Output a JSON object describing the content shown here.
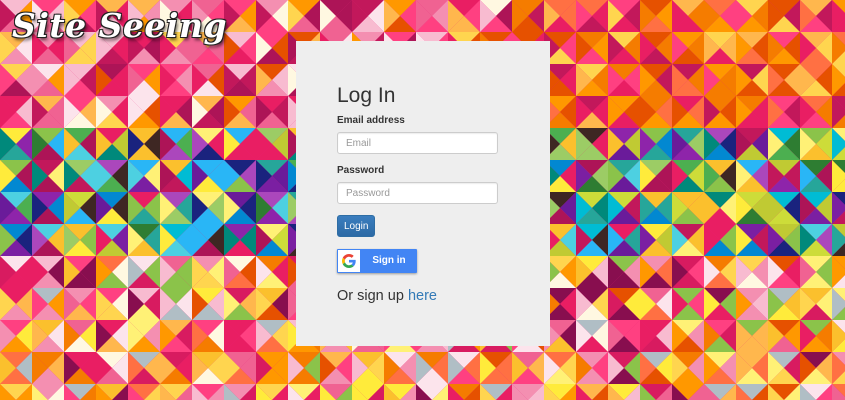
{
  "header": {
    "logo_text": "Site Seeing"
  },
  "login": {
    "title": "Log In",
    "email_label": "Email address",
    "email_placeholder": "Email",
    "email_value": "",
    "password_label": "Password",
    "password_placeholder": "Password",
    "password_value": "",
    "submit_label": "Login"
  },
  "google": {
    "label": "Sign in",
    "icon": "google-g-icon",
    "button_color": "#4285f4"
  },
  "signup": {
    "prefix": "Or sign up",
    "link_text": "here"
  },
  "colors": {
    "panel_bg": "#eeeeee",
    "primary_button": "#337ab7",
    "link": "#337ab7"
  }
}
